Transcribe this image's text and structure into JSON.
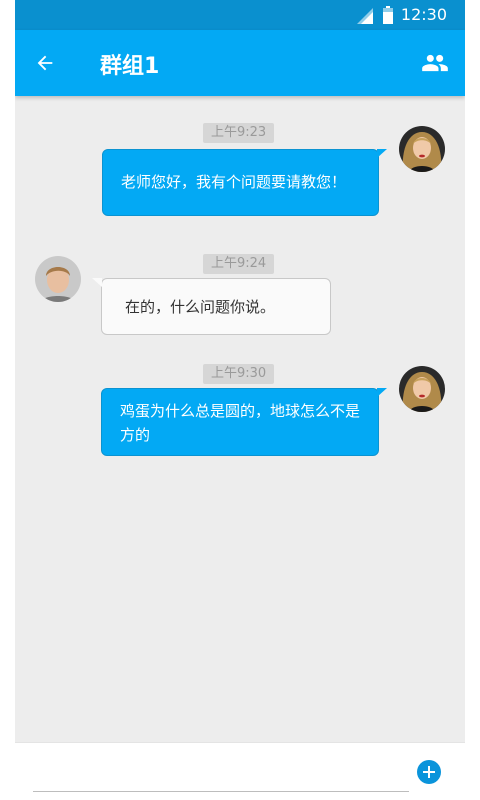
{
  "status_bar": {
    "time": "12:30",
    "signal_icon": "signal-icon",
    "battery_icon": "battery-icon"
  },
  "app_bar": {
    "title": "群组1",
    "back_icon": "arrow-left-icon",
    "group_icon": "group-icon"
  },
  "messages": [
    {
      "direction": "out",
      "time": "上午9:23",
      "text": "老师您好，我有个问题要请教您！",
      "avatar": "avatar-woman"
    },
    {
      "direction": "in",
      "time": "上午9:24",
      "text": "在的，什么问题你说。",
      "avatar": "avatar-man"
    },
    {
      "direction": "out",
      "time": "上午9:30",
      "text": "鸡蛋为什么总是圆的，地球怎么不是方的",
      "avatar": "avatar-woman"
    }
  ],
  "input_bar": {
    "value": "",
    "add_icon": "plus-circle-icon"
  },
  "colors": {
    "status_bar": "#0a90cf",
    "app_bar": "#03a9f4",
    "chat_background": "#ededed",
    "bubble_out": "#03a9f4",
    "bubble_in": "#fafafa",
    "add_button": "#0a94db"
  }
}
